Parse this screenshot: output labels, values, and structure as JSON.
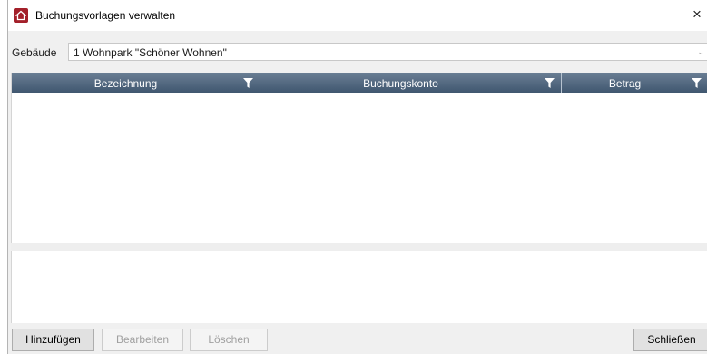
{
  "window": {
    "title": "Buchungsvorlagen verwalten",
    "close_glyph": "×"
  },
  "filter": {
    "label": "Gebäude",
    "selected": "1 Wohnpark \"Schöner Wohnen\"",
    "arrow_glyph": "⌄"
  },
  "grid": {
    "columns": [
      "Bezeichnung",
      "Buchungskonto",
      "Betrag"
    ],
    "rows": [],
    "header_color": "#4d627a",
    "filter_icon": "funnel-icon"
  },
  "buttons": {
    "add": "Hinzufügen",
    "edit": "Bearbeiten",
    "delete": "Löschen",
    "close": "Schließen"
  },
  "colors": {
    "accent": "#a3202a",
    "window_bg": "#f0f0f0"
  }
}
